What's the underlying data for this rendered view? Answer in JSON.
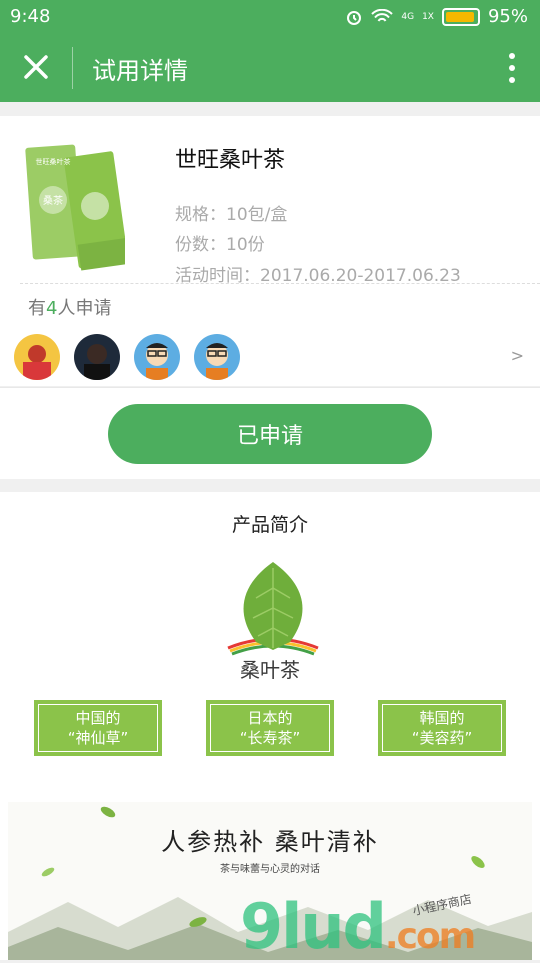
{
  "status": {
    "time": "9:48",
    "battery": "95%",
    "net": "4G",
    "sim": "1X",
    "battery_level": 0.95
  },
  "nav": {
    "title": "试用详情"
  },
  "product": {
    "name": "世旺桑叶茶",
    "spec": "规格：10包/盒",
    "quantity": "份数：10份",
    "period": "活动时间：2017.06.20-2017.06.23",
    "package_label": "世旺桑叶茶",
    "package_logo": "桑茶"
  },
  "applicants": {
    "prefix": "有",
    "count": "4",
    "suffix": "人申请",
    "more": ">"
  },
  "actions": {
    "applied_label": "已申请"
  },
  "intro": {
    "title": "产品简介",
    "logo_text": "桑叶茶",
    "badges": [
      {
        "line1": "中国的",
        "line2": "“神仙草”"
      },
      {
        "line1": "日本的",
        "line2": "“长寿茶”"
      },
      {
        "line1": "韩国的",
        "line2": "“美容药”"
      }
    ],
    "banner_title": "人参热补 桑叶清补",
    "banner_sub": "茶与味蕾与心灵的对话"
  },
  "watermark": {
    "main": "9lud",
    "suffix": ".com",
    "small": "小程序商店"
  },
  "colors": {
    "accent": "#4cae5e",
    "badge": "#8bc34a",
    "count": "#4cae5e"
  }
}
